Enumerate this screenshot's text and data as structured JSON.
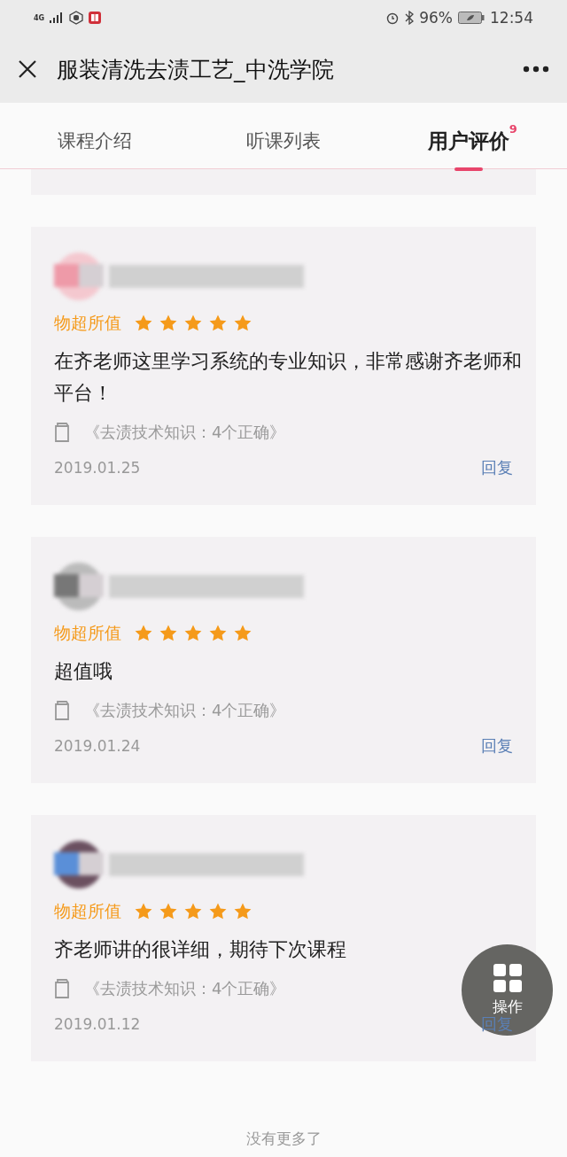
{
  "status_bar": {
    "network": "4G",
    "battery": "96%",
    "time": "12:54"
  },
  "header": {
    "title": "服装清洗去渍工艺_中洗学院"
  },
  "tabs": [
    {
      "label": "课程介绍",
      "selected": false
    },
    {
      "label": "听课列表",
      "selected": false
    },
    {
      "label": "用户评价",
      "selected": true,
      "badge": "9"
    }
  ],
  "reviews": [
    {
      "rating_label": "物超所值",
      "stars": 5,
      "text": "在齐老师这里学习系统的专业知识，非常感谢齐老师和平台！",
      "course": "《去渍技术知识：4个正确》",
      "date": "2019.01.25",
      "reply": "回复"
    },
    {
      "rating_label": "物超所值",
      "stars": 5,
      "text": "超值哦",
      "course": "《去渍技术知识：4个正确》",
      "date": "2019.01.24",
      "reply": "回复"
    },
    {
      "rating_label": "物超所值",
      "stars": 5,
      "text": "齐老师讲的很详细，期待下次课程",
      "course": "《去渍技术知识：4个正确》",
      "date": "2019.01.12",
      "reply": "回复"
    }
  ],
  "fab": {
    "label": "操作"
  },
  "footer": "没有更多了"
}
